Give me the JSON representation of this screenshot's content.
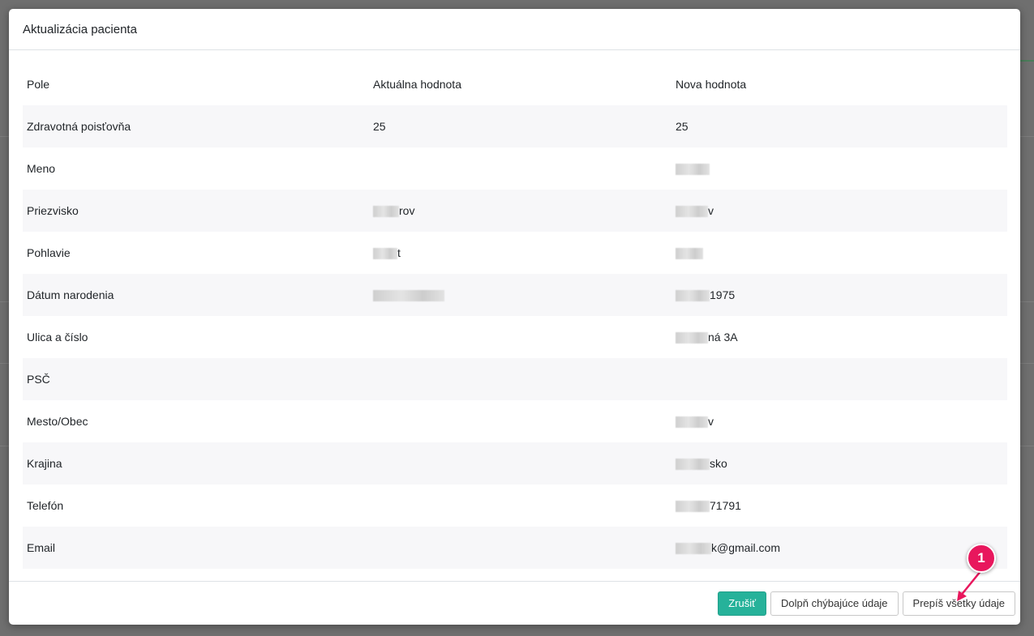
{
  "modal": {
    "title": "Aktualizácia pacienta"
  },
  "table": {
    "headers": [
      "Pole",
      "Aktuálna hodnota",
      "Nova hodnota"
    ],
    "rows": [
      {
        "field": "Zdravotná poisťovňa",
        "current": "25",
        "new": "25"
      },
      {
        "field": "Meno",
        "current": "",
        "new": ""
      },
      {
        "field": "Priezvisko",
        "current": "rov",
        "new": "v"
      },
      {
        "field": "Pohlavie",
        "current": "t",
        "new": ""
      },
      {
        "field": "Dátum narodenia",
        "current": "",
        "new": "1975"
      },
      {
        "field": "Ulica a číslo",
        "current": "",
        "new": "ná 3A"
      },
      {
        "field": "PSČ",
        "current": "",
        "new": ""
      },
      {
        "field": "Mesto/Obec",
        "current": "",
        "new": "v"
      },
      {
        "field": "Krajina",
        "current": "",
        "new": "sko"
      },
      {
        "field": "Telefón",
        "current": "",
        "new": "71791"
      },
      {
        "field": "Email",
        "current": "",
        "new": "k@gmail.com"
      }
    ]
  },
  "footer": {
    "cancel_label": "Zrušiť",
    "fill_missing_label": "Dolpň chýbajúce údaje",
    "overwrite_all_label": "Prepíš všetky údaje"
  },
  "annotation": {
    "step_number": "1",
    "color": "#e8175d"
  },
  "colors": {
    "primary_button": "#26b29a",
    "striped_row": "#f7f7f9"
  }
}
